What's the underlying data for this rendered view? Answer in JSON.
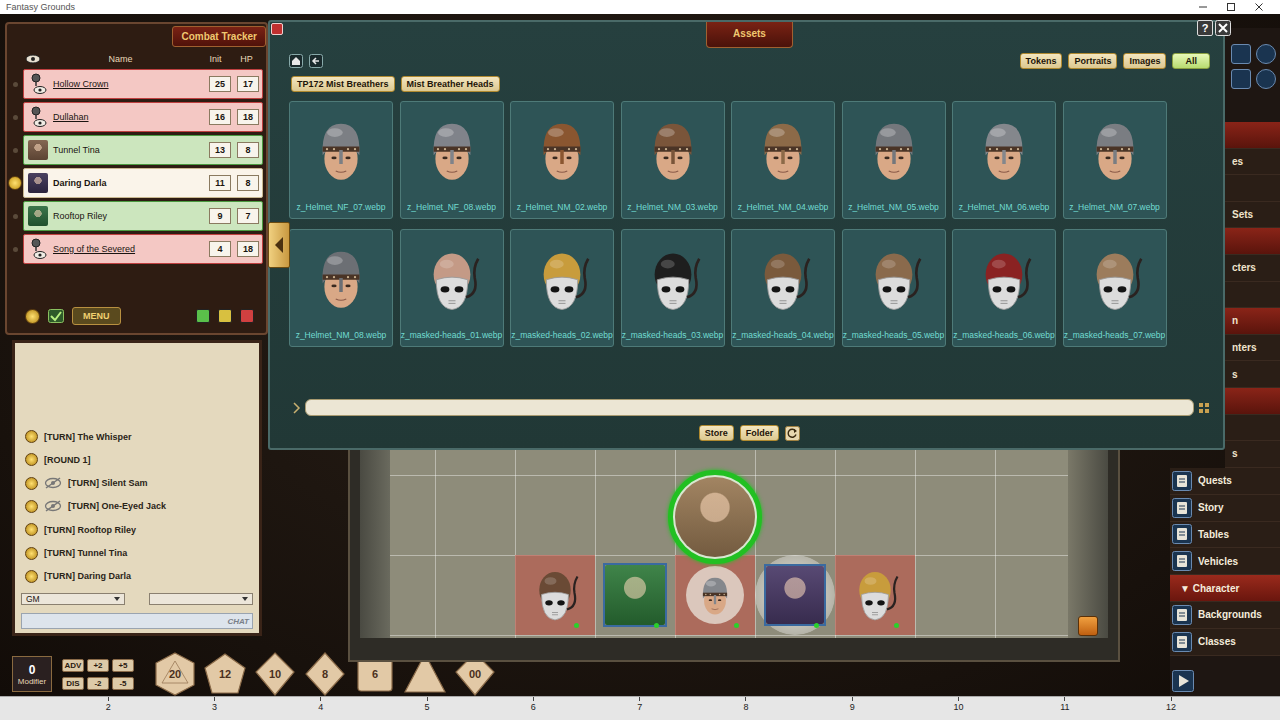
{
  "window": {
    "title": "Fantasy Grounds"
  },
  "combat_tracker": {
    "title": "Combat Tracker",
    "columns": [
      "Name",
      "Init",
      "HP"
    ],
    "rows": [
      {
        "name": "Hollow Crown",
        "init": "25",
        "hp": "17",
        "faction": "foe",
        "active": false
      },
      {
        "name": "Dullahan",
        "init": "16",
        "hp": "18",
        "faction": "foe",
        "active": false
      },
      {
        "name": "Tunnel Tina",
        "init": "13",
        "hp": "8",
        "faction": "friend",
        "active": false,
        "portrait": "#7a5a44"
      },
      {
        "name": "Daring Darla",
        "init": "11",
        "hp": "8",
        "faction": "friend",
        "active": true,
        "portrait": "#3a3052"
      },
      {
        "name": "Rooftop Riley",
        "init": "9",
        "hp": "7",
        "faction": "friend",
        "active": false,
        "portrait": "#2c6a3c"
      },
      {
        "name": "Song of the Severed",
        "init": "4",
        "hp": "18",
        "faction": "foe",
        "active": false
      }
    ],
    "menu_button": "MENU"
  },
  "chat": {
    "entries": [
      {
        "text": "[TURN] The Whisper",
        "hidden": false
      },
      {
        "text": "[ROUND 1]",
        "hidden": false
      },
      {
        "text": "[TURN] Silent Sam",
        "hidden": true
      },
      {
        "text": "[TURN] One-Eyed Jack",
        "hidden": true
      },
      {
        "text": "[TURN] Rooftop Riley",
        "hidden": false
      },
      {
        "text": "[TURN] Tunnel Tina",
        "hidden": false
      },
      {
        "text": "[TURN] Daring Darla",
        "hidden": false
      }
    ],
    "identity": "GM",
    "mode": "",
    "input_label": "CHAT"
  },
  "dice_bar": {
    "modifier": {
      "value": "0",
      "label": "Modifier"
    },
    "buttons": [
      "ADV",
      "+2",
      "+5",
      "DIS",
      "-2",
      "-5"
    ],
    "dice": [
      {
        "kind": "d20",
        "label": "20"
      },
      {
        "kind": "d12",
        "label": "12"
      },
      {
        "kind": "d10",
        "label": "10"
      },
      {
        "kind": "d8",
        "label": "8"
      },
      {
        "kind": "d6",
        "label": "6"
      },
      {
        "kind": "d4",
        "label": ""
      },
      {
        "kind": "d100",
        "label": "00"
      }
    ]
  },
  "assets": {
    "title": "Assets",
    "help": "?",
    "filters": [
      {
        "label": "Tokens",
        "selected": false
      },
      {
        "label": "Portraits",
        "selected": false
      },
      {
        "label": "Images",
        "selected": false
      },
      {
        "label": "All",
        "selected": true
      }
    ],
    "breadcrumbs": [
      "TP172 Mist Breathers",
      "Mist Breather Heads"
    ],
    "items": [
      {
        "name": "z_Helmet_NF_07.webp",
        "kind": "helmet",
        "color": "#7c7f84"
      },
      {
        "name": "z_Helmet_NF_08.webp",
        "kind": "helmet",
        "color": "#80838a"
      },
      {
        "name": "z_Helmet_NM_02.webp",
        "kind": "helmet",
        "color": "#8a5630"
      },
      {
        "name": "z_Helmet_NM_03.webp",
        "kind": "helmet",
        "color": "#7a553a"
      },
      {
        "name": "z_Helmet_NM_04.webp",
        "kind": "helmet",
        "color": "#8c6a48"
      },
      {
        "name": "z_Helmet_NM_05.webp",
        "kind": "helmet",
        "color": "#74777c"
      },
      {
        "name": "z_Helmet_NM_06.webp",
        "kind": "helmet",
        "color": "#84878c"
      },
      {
        "name": "z_Helmet_NM_07.webp",
        "kind": "helmet",
        "color": "#7a7d82"
      },
      {
        "name": "z_Helmet_NM_08.webp",
        "kind": "helmet",
        "color": "#6c6f74"
      },
      {
        "name": "z_masked-heads_01.webp",
        "kind": "masked",
        "color": "#c49a86"
      },
      {
        "name": "z_masked-heads_02.webp",
        "kind": "masked",
        "color": "#c89c3c"
      },
      {
        "name": "z_masked-heads_03.webp",
        "kind": "masked",
        "color": "#1e1e1e"
      },
      {
        "name": "z_masked-heads_04.webp",
        "kind": "masked",
        "color": "#7a5a3c"
      },
      {
        "name": "z_masked-heads_05.webp",
        "kind": "masked",
        "color": "#8a6a4c"
      },
      {
        "name": "z_masked-heads_06.webp",
        "kind": "masked",
        "color": "#8a2222"
      },
      {
        "name": "z_masked-heads_07.webp",
        "kind": "masked",
        "color": "#9c7c5c"
      }
    ],
    "search": {
      "value": ""
    },
    "buttons": [
      "Store",
      "Folder"
    ]
  },
  "map": {
    "tokens": [
      {
        "kind": "masked",
        "faction": "foe",
        "color": "#6a4a35",
        "active": false
      },
      {
        "kind": "portrait",
        "faction": "friend",
        "color": "#2f7a3a",
        "active": false
      },
      {
        "kind": "helmet",
        "faction": "foe",
        "color": "#84878c",
        "active": false
      },
      {
        "kind": "portrait",
        "faction": "friend",
        "color": "#4a3a68",
        "active": true
      },
      {
        "kind": "masked",
        "faction": "foe",
        "color": "#c89c3c",
        "active": false
      }
    ],
    "selected_token": {
      "kind": "portrait",
      "color": "#9a7a55",
      "selected": true
    }
  },
  "sidebar": {
    "upper_items": [
      {
        "label": "",
        "kind": "header"
      },
      {
        "label": "es",
        "kind": "item"
      },
      {
        "label": "",
        "kind": "item"
      },
      {
        "label": "Sets",
        "kind": "item"
      },
      {
        "label": "",
        "kind": "header"
      },
      {
        "label": "cters",
        "kind": "item"
      },
      {
        "label": "",
        "kind": "item"
      },
      {
        "label": "n",
        "kind": "header"
      },
      {
        "label": "nters",
        "kind": "item"
      },
      {
        "label": "s",
        "kind": "item"
      },
      {
        "label": "",
        "kind": "header"
      },
      {
        "label": "",
        "kind": "item"
      },
      {
        "label": "s",
        "kind": "item"
      }
    ],
    "items": [
      {
        "label": "Quests",
        "kind": "item"
      },
      {
        "label": "Story",
        "kind": "item"
      },
      {
        "label": "Tables",
        "kind": "item"
      },
      {
        "label": "Vehicles",
        "kind": "item"
      },
      {
        "label": "▼ Character",
        "kind": "header"
      },
      {
        "label": "Backgrounds",
        "kind": "item"
      },
      {
        "label": "Classes",
        "kind": "item"
      }
    ]
  },
  "ruler": {
    "ticks": [
      "2",
      "3",
      "4",
      "5",
      "6",
      "7",
      "8",
      "9",
      "10",
      "11",
      "12"
    ]
  }
}
